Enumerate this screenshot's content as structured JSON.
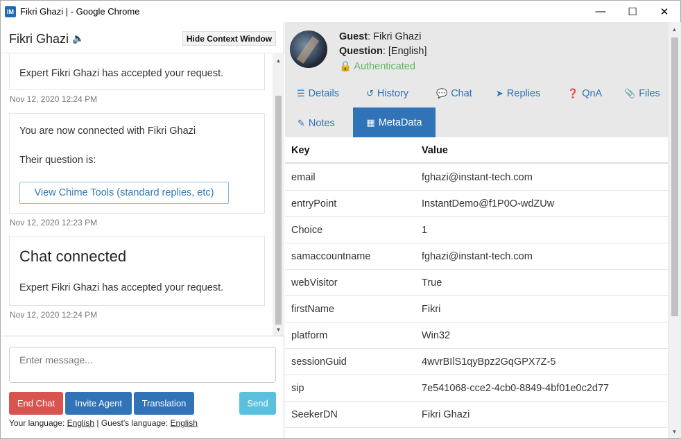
{
  "window": {
    "app_icon": "IM",
    "title": "Fikri Ghazi | - Google Chrome",
    "controls": [
      "minimize-icon",
      "maximize-icon",
      "close-icon"
    ]
  },
  "chat": {
    "agent_name": "Fikri Ghazi",
    "hide_context_label": "Hide Context Window",
    "cards": [
      {
        "text": "Expert Fikri Ghazi has accepted your request.",
        "time": "Nov 12, 2020 12:24 PM"
      },
      {
        "line1": "You are now connected with Fikri Ghazi",
        "line2": "Their question is:",
        "button": "View Chime Tools (standard replies, etc)",
        "time": "Nov 12, 2020 12:23 PM"
      },
      {
        "heading": "Chat connected",
        "text": "Expert Fikri Ghazi has accepted your request.",
        "time": "Nov 12, 2020 12:24 PM"
      }
    ],
    "input_placeholder": "Enter message...",
    "buttons": {
      "end_chat": "End Chat",
      "invite_agent": "Invite Agent",
      "translation": "Translation",
      "send": "Send"
    },
    "language": {
      "your_label": "Your language:",
      "your_value": "English",
      "separator": "|",
      "guest_label": "Guest's language:",
      "guest_value": "English"
    }
  },
  "context": {
    "guest_label": "Guest",
    "guest_value": ": Fikri Ghazi",
    "question_label": "Question",
    "question_value": ": [English]",
    "auth_status": "Authenticated",
    "tabs": [
      "Details",
      "History",
      "Chat",
      "Replies",
      "QnA",
      "Files",
      "Notes",
      "MetaData"
    ],
    "active_tab": "MetaData",
    "table": {
      "headers": [
        "Key",
        "Value"
      ],
      "rows": [
        [
          "email",
          "fghazi@instant-tech.com"
        ],
        [
          "entryPoint",
          "InstantDemo@f1P0O-wdZUw"
        ],
        [
          "Choice",
          "1"
        ],
        [
          "samaccountname",
          "fghazi@instant-tech.com"
        ],
        [
          "webVisitor",
          "True"
        ],
        [
          "firstName",
          "Fikri"
        ],
        [
          "platform",
          "Win32"
        ],
        [
          "sessionGuid",
          "4wvrBIlS1qyBpz2GqGPX7Z-5"
        ],
        [
          "sip",
          "7e541068-cce2-4cb0-8849-4bf01e0c2d77"
        ],
        [
          "SeekerDN",
          "Fikri Ghazi"
        ]
      ]
    }
  },
  "colors": {
    "primary": "#3173b7",
    "danger": "#d9534f",
    "info": "#5bc0de",
    "success": "#5cb85c"
  }
}
